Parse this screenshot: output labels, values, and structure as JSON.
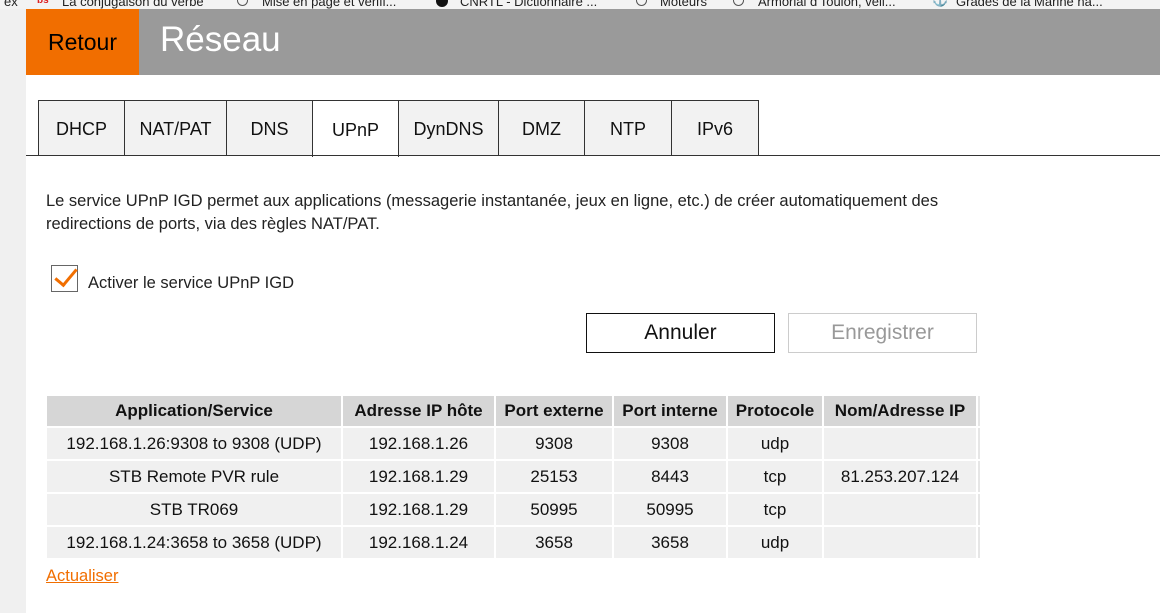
{
  "bookmarks": [
    {
      "label": "ex"
    },
    {
      "label": "La conjugaison du verbe"
    },
    {
      "label": "Mise en page et vérifi..."
    },
    {
      "label": "CNRTL - Dictionnaire ..."
    },
    {
      "label": "Moteurs"
    },
    {
      "label": "Armorial d'Toulon, veil..."
    },
    {
      "label": "Grades de la Marine na..."
    }
  ],
  "header": {
    "back_label": "Retour",
    "title": "Réseau"
  },
  "tabs": [
    {
      "label": "DHCP"
    },
    {
      "label": "NAT/PAT"
    },
    {
      "label": "DNS"
    },
    {
      "label": "UPnP",
      "active": true
    },
    {
      "label": "DynDNS"
    },
    {
      "label": "DMZ"
    },
    {
      "label": "NTP"
    },
    {
      "label": "IPv6"
    }
  ],
  "description": "Le service UPnP IGD permet aux applications (messagerie instantanée, jeux en ligne, etc.) de créer automatiquement des redirections de ports, via des règles NAT/PAT.",
  "enable_checkbox": {
    "label": "Activer le service UPnP IGD",
    "checked": true
  },
  "buttons": {
    "cancel": "Annuler",
    "save": "Enregistrer"
  },
  "table": {
    "headers": [
      "Application/Service",
      "Adresse IP hôte",
      "Port externe",
      "Port interne",
      "Protocole",
      "Nom/Adresse IP"
    ],
    "rows": [
      [
        "192.168.1.26:9308 to 9308 (UDP)",
        "192.168.1.26",
        "9308",
        "9308",
        "udp",
        ""
      ],
      [
        "STB Remote PVR rule",
        "192.168.1.29",
        "25153",
        "8443",
        "tcp",
        "81.253.207.124"
      ],
      [
        "STB TR069",
        "192.168.1.29",
        "50995",
        "50995",
        "tcp",
        ""
      ],
      [
        "192.168.1.24:3658 to 3658 (UDP)",
        "192.168.1.24",
        "3658",
        "3658",
        "udp",
        ""
      ]
    ]
  },
  "refresh_link": "Actualiser",
  "colors": {
    "accent": "#f16e00",
    "header_bg": "#9a9a9a"
  }
}
